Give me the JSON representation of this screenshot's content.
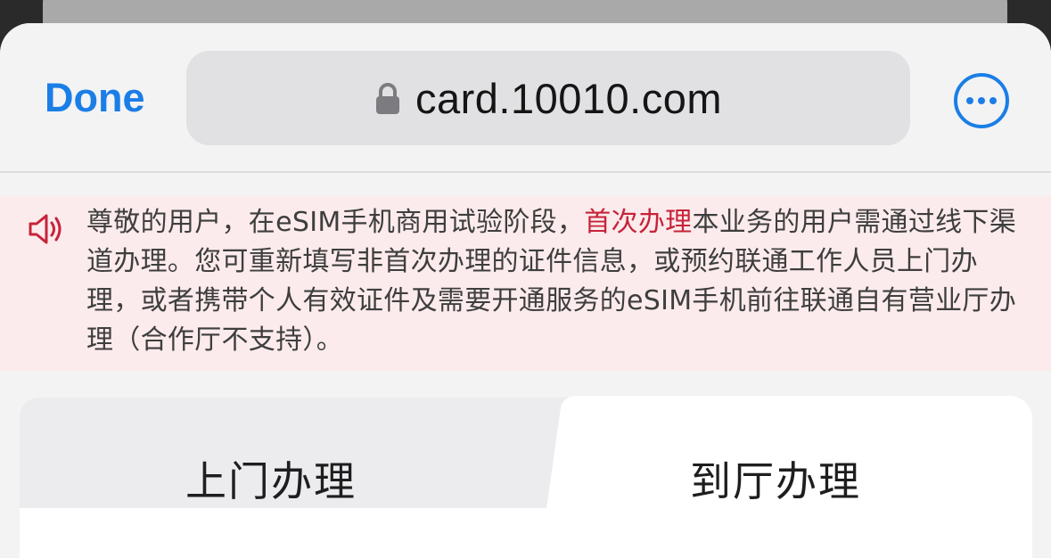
{
  "toolbar": {
    "done_label": "Done",
    "url": "card.10010.com",
    "lock_icon": "lock-icon",
    "more_icon": "ellipsis-circle-icon",
    "accent_color": "#1b7ee6"
  },
  "notice": {
    "icon": "speaker-icon",
    "text_before": "尊敬的用户，在eSIM手机商用试验阶段，",
    "highlight": "首次办理",
    "text_after": "本业务的用户需通过线下渠道办理。您可重新填写非首次办理的证件信息，或预约联通工作人员上门办理，或者携带个人有效证件及需要开通服务的eSIM手机前往联通自有营业厅办理（合作厅不支持）。",
    "highlight_color": "#c7233a",
    "background_color": "#fcebec"
  },
  "tabs": [
    {
      "label": "上门办理",
      "selected": false
    },
    {
      "label": "到厅办理",
      "selected": true
    }
  ]
}
